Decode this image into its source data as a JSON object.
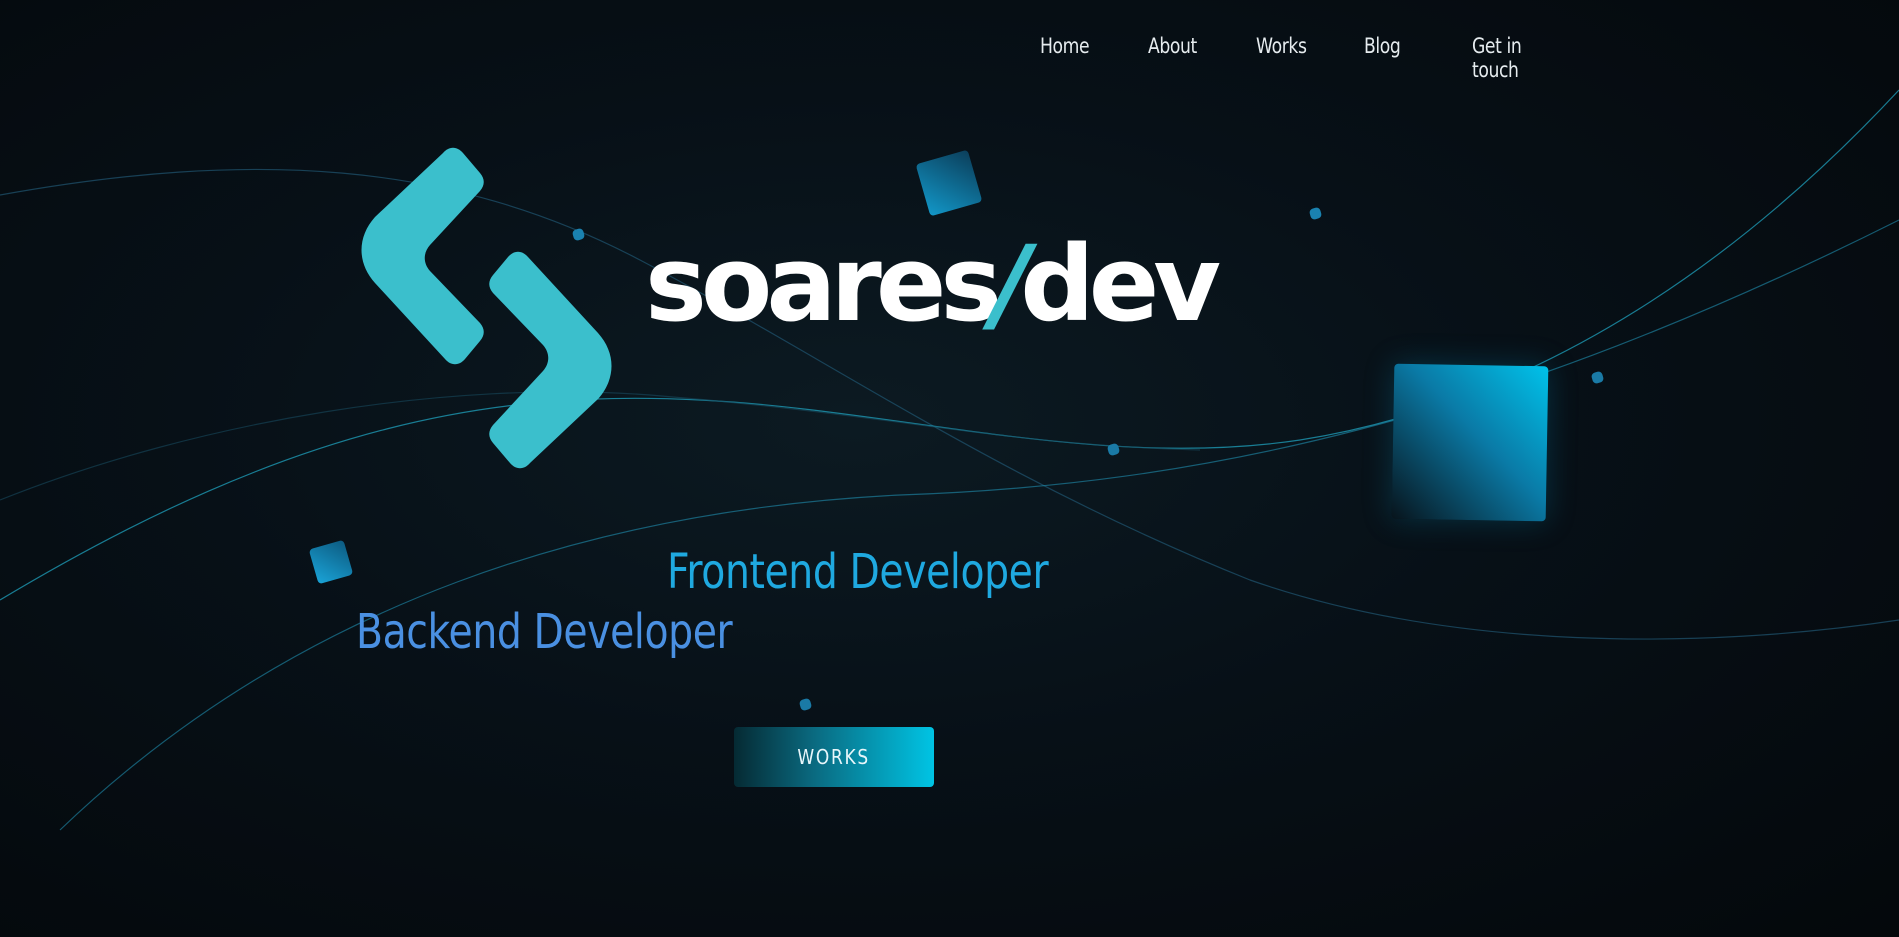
{
  "nav": {
    "items": [
      "Home",
      "About",
      "Works",
      "Blog",
      "Get in touch"
    ]
  },
  "brand": {
    "name_part1": "soares",
    "name_slash": "/",
    "name_part2": "dev",
    "accent_color": "#3bbfcc"
  },
  "hero": {
    "role_1": "Frontend Developer",
    "role_2": "Backend Developer",
    "cta_label": "WORKS"
  },
  "colors": {
    "background": "#060c10",
    "role_1": "#1fa9e0",
    "role_2": "#4a90e2",
    "button_gradient_end": "#00c4e4"
  }
}
